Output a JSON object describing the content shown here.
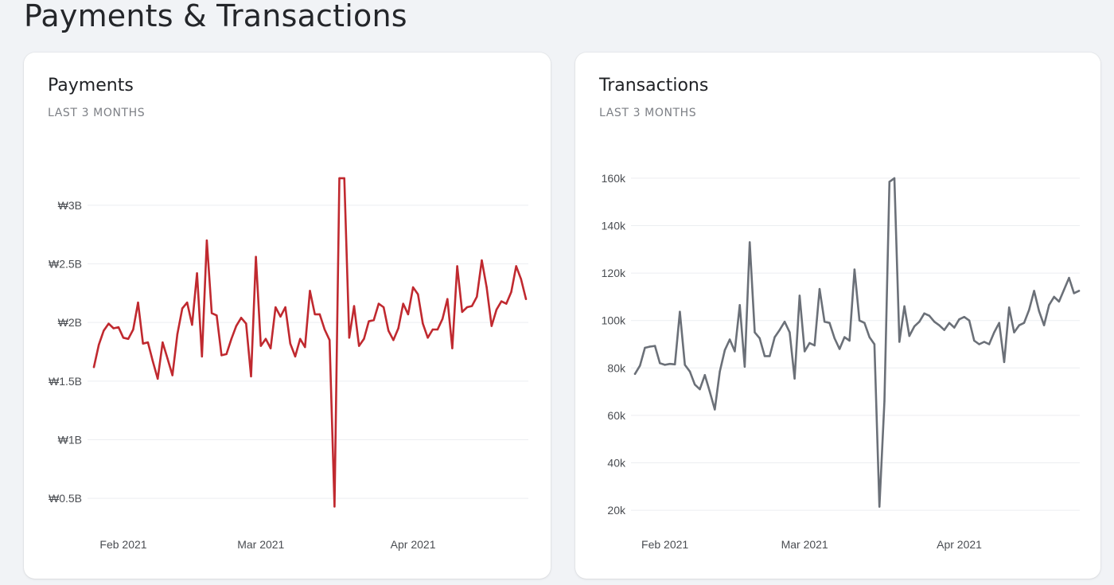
{
  "page": {
    "title": "Payments & Transactions"
  },
  "colors": {
    "payments_line": "#c0292f",
    "transactions_line": "#6b7078",
    "grid": "#eceef1",
    "card_bg": "#ffffff",
    "page_bg": "#f1f3f6"
  },
  "cards": [
    {
      "title": "Payments",
      "subtitle": "LAST 3 MONTHS"
    },
    {
      "title": "Transactions",
      "subtitle": "LAST 3 MONTHS"
    }
  ],
  "chart_data": [
    {
      "type": "line",
      "ylim": [
        0.25,
        3.25
      ],
      "y_ticks": [
        0.5,
        1,
        1.5,
        2,
        2.5,
        3
      ],
      "y_tick_labels": [
        "₩0.5B",
        "₩1B",
        "₩1.5B",
        "₩2B",
        "₩2.5B",
        "₩3B"
      ],
      "x_tick_labels": [
        "Feb 2021",
        "Mar 2021",
        "Apr 2021"
      ],
      "x_tick_index": [
        6,
        34,
        65
      ],
      "grid": true,
      "series": [
        {
          "values": [
            1.62,
            1.81,
            1.93,
            1.99,
            1.95,
            1.96,
            1.87,
            1.86,
            1.94,
            2.17,
            1.82,
            1.83,
            1.67,
            1.52,
            1.83,
            1.69,
            1.55,
            1.9,
            2.12,
            2.17,
            1.98,
            2.42,
            1.71,
            2.7,
            2.08,
            2.06,
            1.72,
            1.73,
            1.86,
            1.97,
            2.04,
            1.99,
            1.54,
            2.56,
            1.8,
            1.86,
            1.78,
            2.13,
            2.05,
            2.13,
            1.82,
            1.71,
            1.86,
            1.79,
            2.27,
            2.07,
            2.07,
            1.94,
            1.85,
            0.43,
            3.23,
            3.23,
            1.87,
            2.14,
            1.8,
            1.86,
            2.01,
            2.02,
            2.16,
            2.13,
            1.93,
            1.85,
            1.95,
            2.16,
            2.07,
            2.3,
            2.24,
            1.99,
            1.87,
            1.94,
            1.94,
            2.03,
            2.2,
            1.78,
            2.48,
            2.09,
            2.13,
            2.14,
            2.22,
            2.53,
            2.3,
            1.97,
            2.11,
            2.18,
            2.16,
            2.26,
            2.48,
            2.37,
            2.2
          ]
        }
      ]
    },
    {
      "type": "line",
      "ylim": [
        15,
        165
      ],
      "y_ticks": [
        20,
        40,
        60,
        80,
        100,
        120,
        140,
        160
      ],
      "y_tick_labels": [
        "20k",
        "40k",
        "60k",
        "80k",
        "100k",
        "120k",
        "140k",
        "160k"
      ],
      "x_tick_labels": [
        "Feb 2021",
        "Mar 2021",
        "Apr 2021"
      ],
      "x_tick_index": [
        6,
        34,
        65
      ],
      "grid": true,
      "series": [
        {
          "values": [
            77.5,
            81,
            88.5,
            89,
            89.3,
            82,
            81.3,
            81.7,
            81.5,
            103.7,
            81.3,
            78.5,
            73,
            71,
            77,
            70,
            62.5,
            78.5,
            87.5,
            92,
            87,
            106.5,
            80.5,
            133,
            95,
            92.5,
            85,
            85,
            93,
            96,
            99.5,
            95,
            75.5,
            110.5,
            87,
            90.5,
            89.5,
            113.3,
            99.5,
            99,
            92.5,
            88,
            93,
            91.5,
            121.5,
            100,
            99,
            93,
            90,
            21.5,
            66,
            158.5,
            160,
            91,
            106,
            93.5,
            97.5,
            99.5,
            103,
            102,
            99.5,
            98,
            96,
            99,
            97,
            100.5,
            101.5,
            100,
            91.5,
            90,
            91,
            90,
            95,
            99,
            82.5,
            105.5,
            95,
            98,
            99,
            104.5,
            112.5,
            104,
            98,
            106.5,
            110,
            108,
            113,
            118,
            111.5,
            112.5
          ]
        }
      ]
    }
  ]
}
